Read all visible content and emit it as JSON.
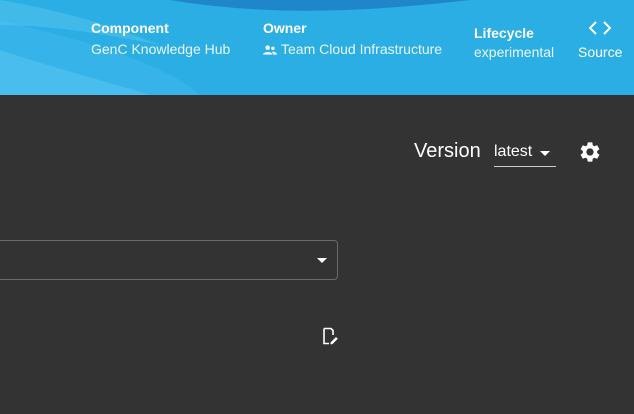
{
  "header": {
    "component": {
      "label": "Component",
      "value": "GenC Knowledge Hub"
    },
    "owner": {
      "label": "Owner",
      "value": "Team Cloud Infrastructure",
      "icon": "group-icon"
    },
    "lifecycle": {
      "label": "Lifecycle",
      "value": "experimental"
    },
    "source": {
      "label": "Source",
      "icon": "code-icon"
    }
  },
  "toolbar": {
    "version_label": "Version",
    "version_value": "latest",
    "settings_icon": "gear-icon"
  },
  "content": {
    "dropdown_value": "",
    "edit_icon": "edit-document-icon"
  },
  "colors": {
    "header_bg": "#2aaee4",
    "page_bg": "#333333",
    "text": "#ffffff"
  }
}
